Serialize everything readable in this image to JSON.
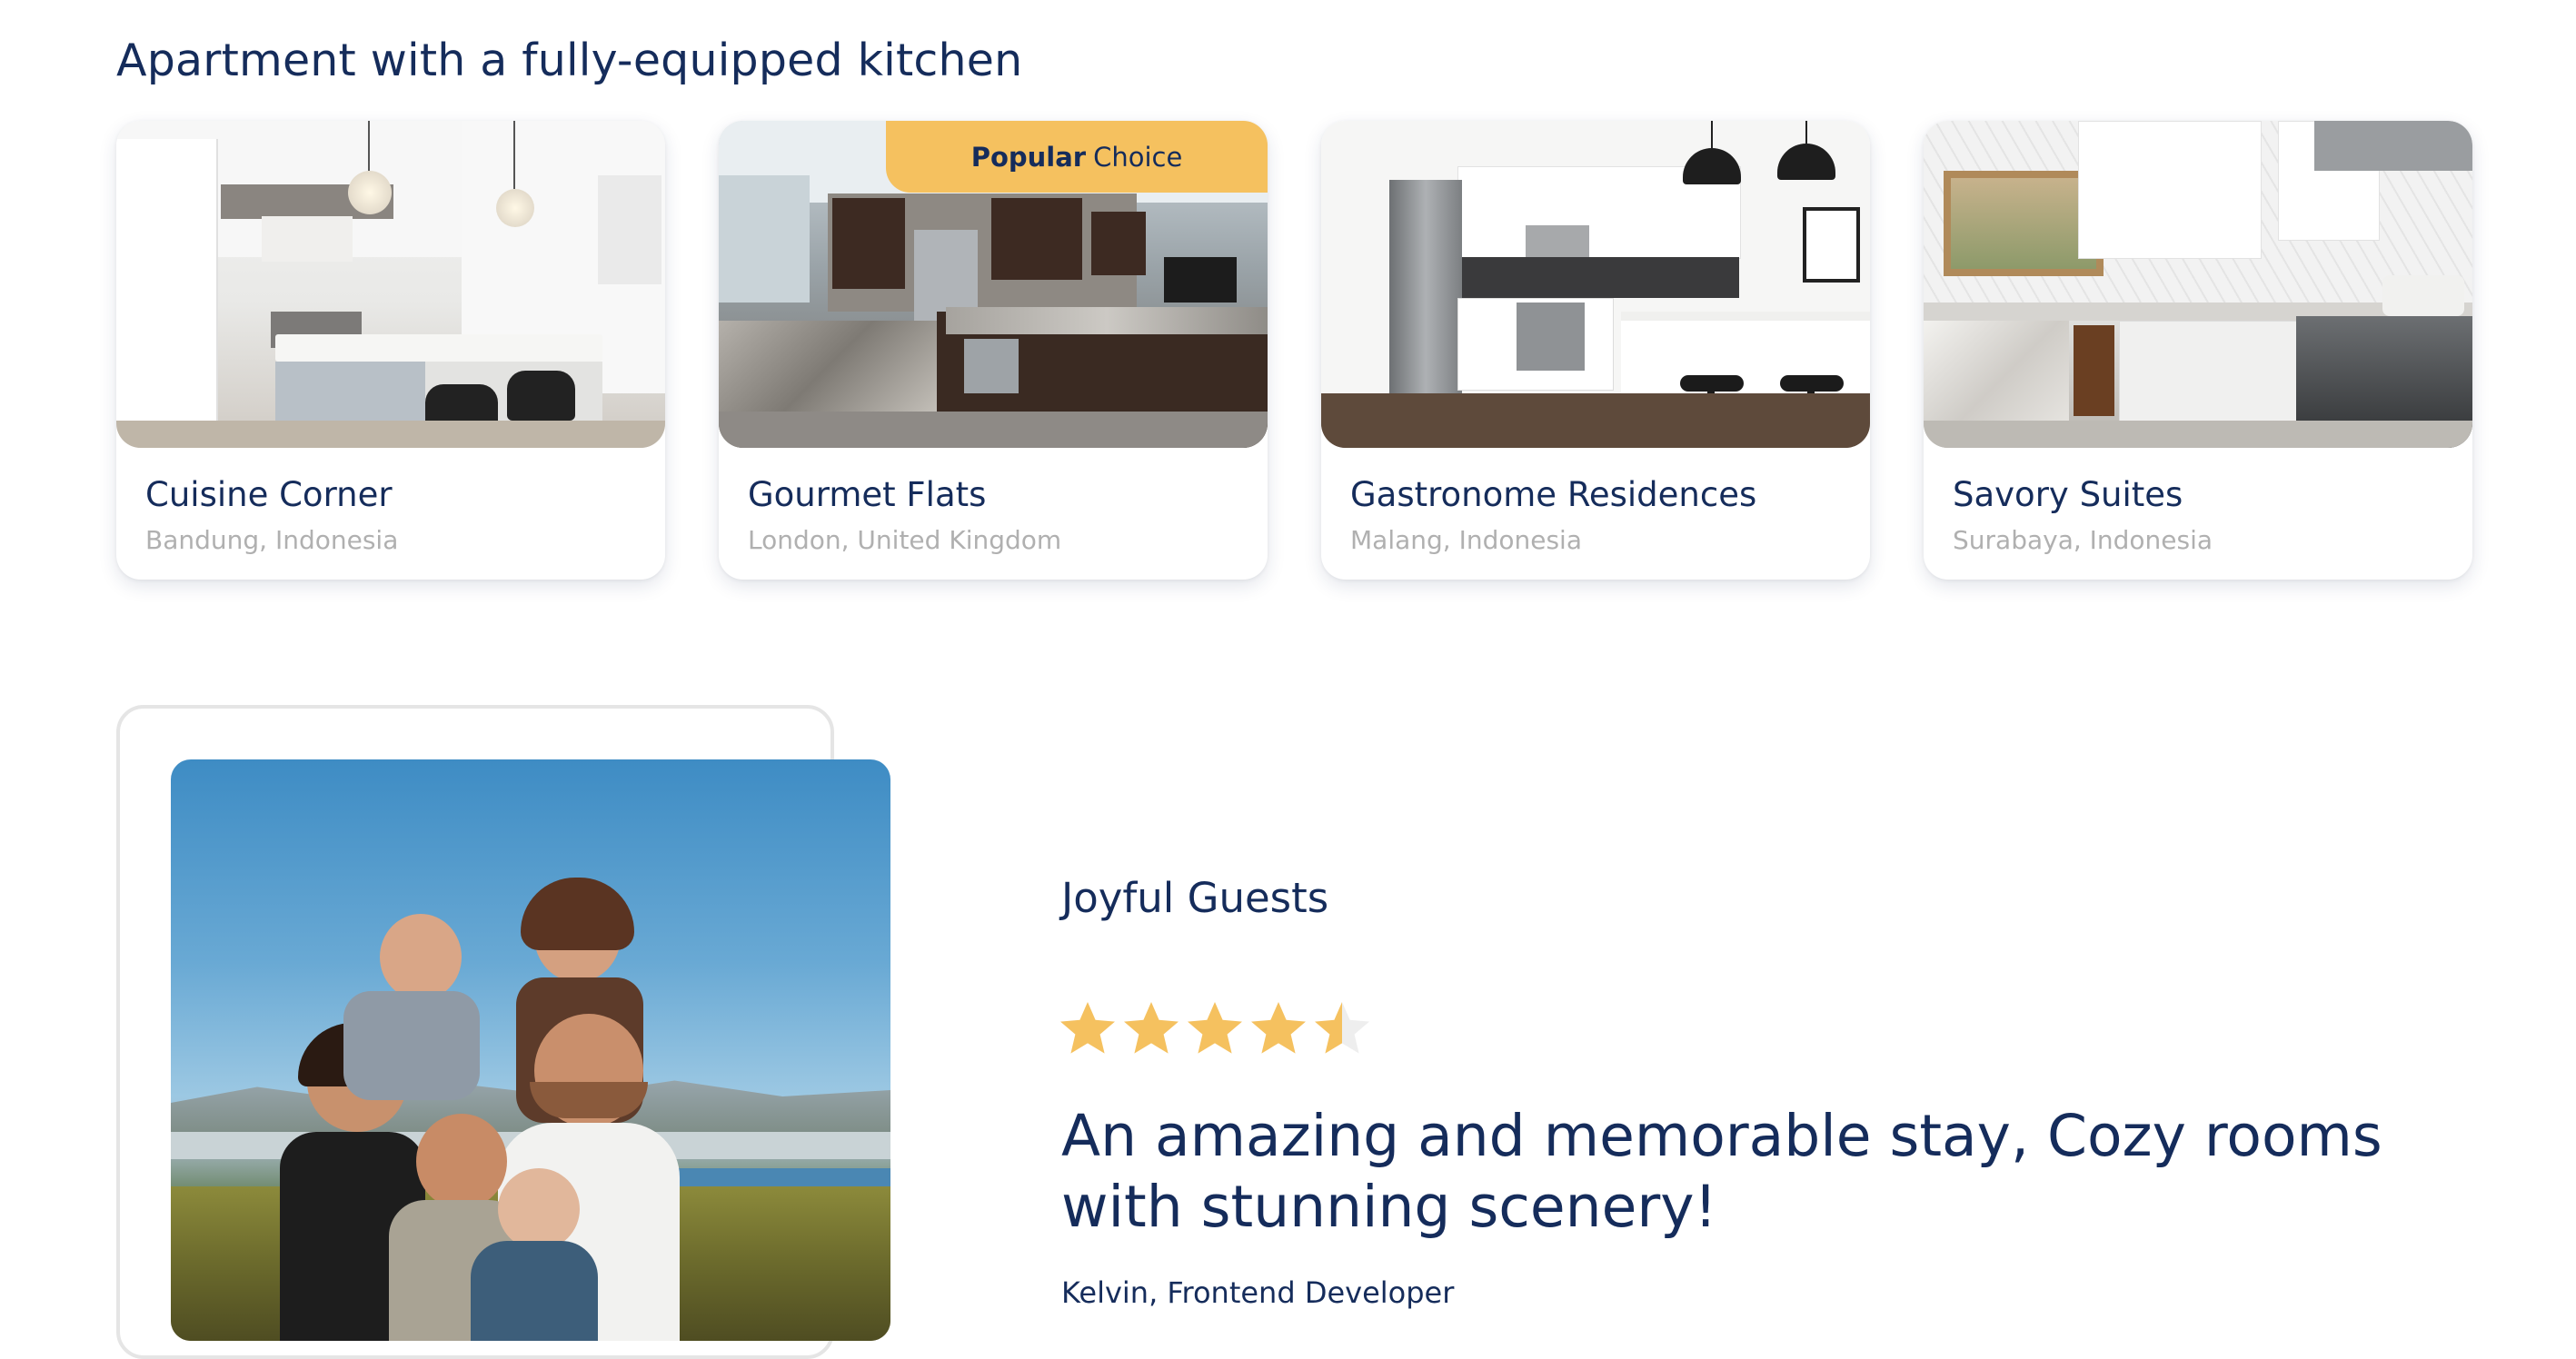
{
  "section": {
    "title": "Apartment with a fully-equipped kitchen"
  },
  "cards": [
    {
      "name": "Cuisine Corner",
      "location": "Bandung, Indonesia",
      "image": "white-kitchen-island-photo"
    },
    {
      "name": "Gourmet Flats",
      "location": "London, United Kingdom",
      "image": "granite-kitchen-photo",
      "badge_strong": "Popular",
      "badge_rest": "Choice"
    },
    {
      "name": "Gastronome Residences",
      "location": "Malang, Indonesia",
      "image": "modern-kitchen-pendant-lights-photo"
    },
    {
      "name": "Savory Suites",
      "location": "Surabaya, Indonesia",
      "image": "hexagon-tile-kitchen-photo"
    }
  ],
  "testimonial": {
    "title": "Joyful Guests",
    "rating": 4.5,
    "rating_max": 5,
    "quote": "An amazing and memorable stay, Cozy rooms with stunning scenery!",
    "author": "Kelvin, Frontend Developer",
    "photo": "family-outdoor-photo"
  },
  "colors": {
    "primary": "#152c5b",
    "accent": "#f5c15f",
    "muted": "#b0b0b0",
    "star": "#f5c15f",
    "star_empty": "#eeeeee"
  }
}
